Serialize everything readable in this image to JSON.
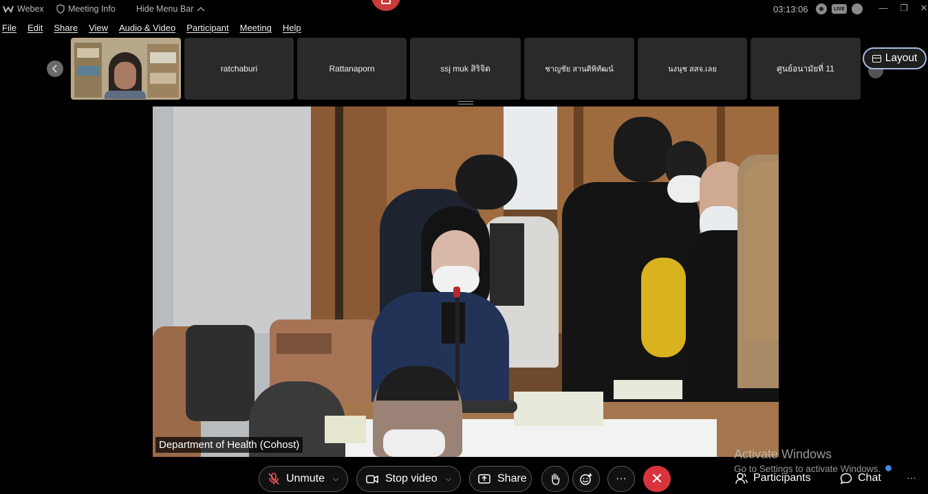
{
  "titlebar": {
    "app_name": "Webex",
    "meeting_info": "Meeting Info",
    "hide_menu_bar": "Hide Menu Bar",
    "clock": "03:13:06",
    "live_badge": "LIVE",
    "icons": [
      "webex-logo-icon",
      "shield-icon",
      "chevron-up-icon",
      "recording-icon",
      "live-icon",
      "signal-icon",
      "minimize-icon",
      "maximize-icon",
      "close-icon"
    ],
    "min_glyph": "—",
    "max_glyph": "❐",
    "close_glyph": "✕"
  },
  "menu": {
    "items": [
      "File",
      "Edit",
      "Share",
      "View",
      "Audio & Video",
      "Participant",
      "Meeting",
      "Help"
    ]
  },
  "filmstrip": {
    "participants": [
      "ratchaburi",
      "Rattanaporn",
      "ssj muk สิริจิต",
      "ชาญชัย สานติพิทัฒน์",
      "นงนุช สสจ.เลย",
      "ศูนย์อนามัยที่ 11"
    ],
    "layout_label": "Layout"
  },
  "main_video": {
    "name_label": "Department of Health (Cohost)"
  },
  "toolbar": {
    "unmute_label": "Unmute",
    "stop_video_label": "Stop video",
    "share_label": "Share",
    "more_glyph": "···",
    "leave_glyph": "✕",
    "participants_label": "Participants",
    "chat_label": "Chat",
    "overflow_glyph": "···"
  },
  "watermark": {
    "line1": "Activate Windows",
    "line2": "Go to Settings to activate Windows."
  },
  "colors": {
    "background": "#000000",
    "tile_bg": "#2a2a2a",
    "leave_red": "#d9343d",
    "layout_border": "#a9bfe0",
    "chat_dot": "#3f8ae6"
  }
}
